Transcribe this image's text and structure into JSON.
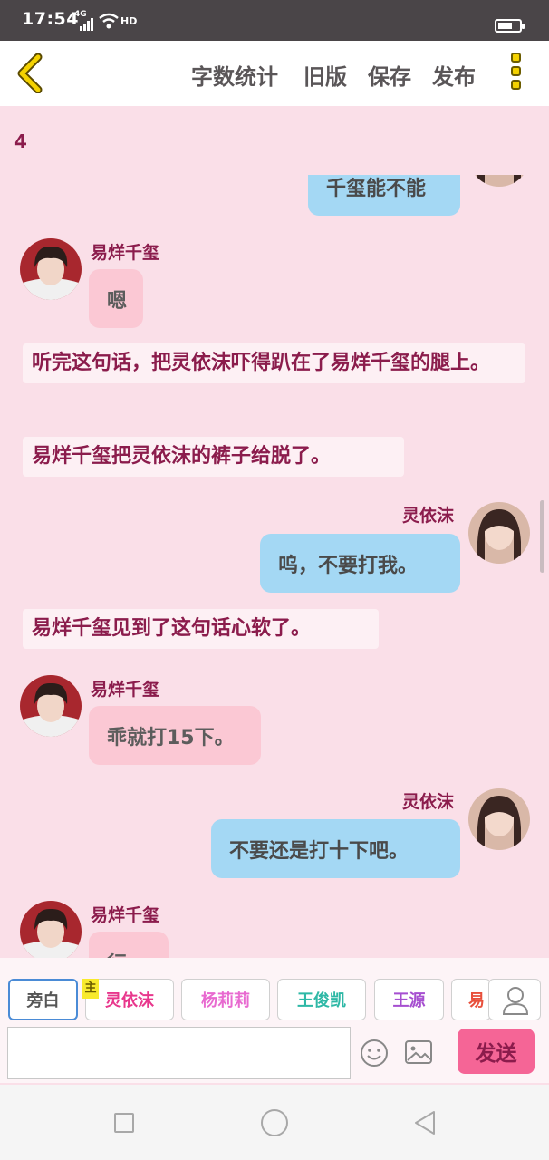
{
  "status_bar": {
    "time": "17:54",
    "network": "4G",
    "hd_label": "HD",
    "battery_level": 0.7
  },
  "toolbar": {
    "icons": [
      "chevron-left-icon",
      "more-vertical-icon"
    ],
    "buttons": [
      "字数统计",
      "旧版",
      "保存",
      "发布"
    ]
  },
  "chapter_number": "4",
  "messages": [
    {
      "type": "right",
      "text": "千玺能不能"
    },
    {
      "type": "left",
      "name": "易烊千玺",
      "text": "嗯"
    },
    {
      "type": "narration",
      "text": "听完这句话，把灵依沫吓得趴在了易烊千玺的腿上。"
    },
    {
      "type": "narration",
      "text": "易烊千玺把灵依沫的裤子给脱了。"
    },
    {
      "type": "right",
      "name": "灵依沫",
      "text": "呜，不要打我。"
    },
    {
      "type": "narration",
      "text": "易烊千玺见到了这句话心软了。"
    },
    {
      "type": "left",
      "name": "易烊千玺",
      "text": "乖就打15下。"
    },
    {
      "type": "right",
      "name": "灵依沫",
      "text": "不要还是打十下吧。"
    },
    {
      "type": "left",
      "name": "易烊千玺",
      "text": "行"
    }
  ],
  "roles": {
    "items": [
      "旁白",
      "灵依沫",
      "杨莉莉",
      "王俊凯",
      "王源",
      "易"
    ],
    "colors": [
      "#555555",
      "#e8378c",
      "#e86ad0",
      "#2eb8a6",
      "#a64fd0",
      "#e8503c"
    ],
    "main_badge": "主",
    "selected": "旁白"
  },
  "composer": {
    "placeholder": "",
    "send_label": "发送",
    "icons": [
      "emoji-icon",
      "image-icon",
      "user-icon"
    ]
  },
  "colors": {
    "page_bg": "#fadfe8",
    "left_bubble": "#fbc8d4",
    "right_bubble": "#a4d8f4",
    "accent": "#8b1c4c",
    "send": "#f56596"
  }
}
